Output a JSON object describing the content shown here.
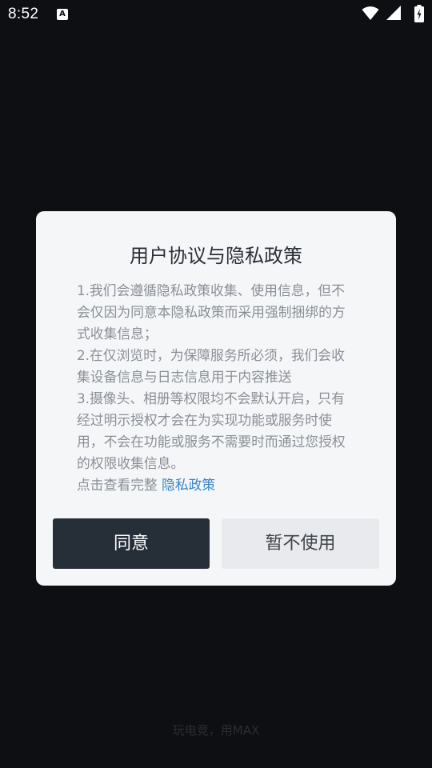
{
  "status_bar": {
    "time": "8:52",
    "notification_icon_letter": "A"
  },
  "dialog": {
    "title": "用户协议与隐私政策",
    "paragraphs": [
      "1.我们会遵循隐私政策收集、使用信息，但不会仅因为同意本隐私政策而采用强制捆绑的方式收集信息；",
      "2.在仅浏览时，为保障服务所必须，我们会收集设备信息与日志信息用于内容推送",
      "3.摄像头、相册等权限均不会默认开启，只有经过明示授权才会在为实现功能或服务时使用，不会在功能或服务不需要时而通过您授权的权限收集信息。"
    ],
    "view_full_prefix": "点击查看完整",
    "policy_link": "隐私政策",
    "agree_button": "同意",
    "decline_button": "暂不使用"
  },
  "footer": {
    "slogan": "玩电竞，用MAX"
  },
  "colors": {
    "background": "#0d0f12",
    "dialog_bg": "#f4f6f8",
    "agree_bg": "#262e38",
    "decline_bg": "#e8eaed",
    "link": "#3a86c8"
  }
}
